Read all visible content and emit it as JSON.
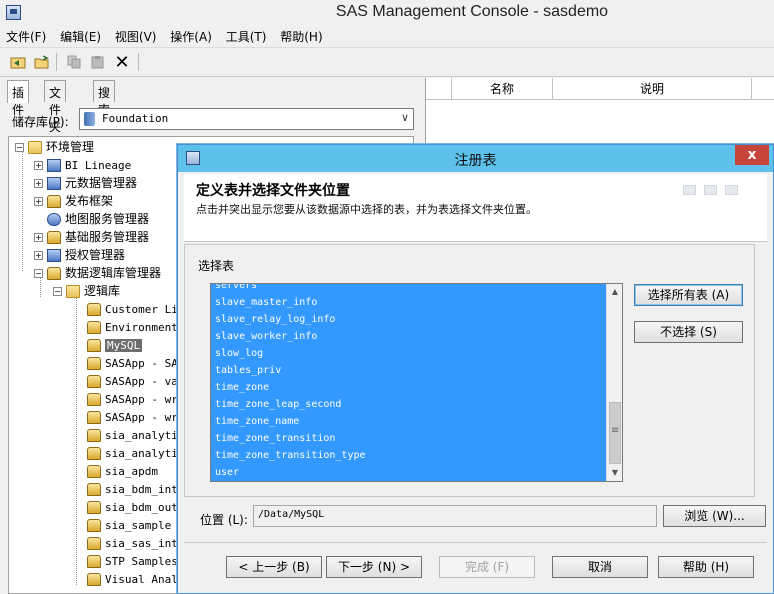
{
  "window": {
    "title": "SAS Management Console - sasdemo"
  },
  "menu": [
    "文件(F)",
    "编辑(E)",
    "视图(V)",
    "操作(A)",
    "工具(T)",
    "帮助(H)"
  ],
  "left_panel": {
    "tabs": [
      "插件",
      "文件夹",
      "搜索"
    ],
    "repository_label": "储存库(P):",
    "repository_value": "Foundation",
    "tree": [
      {
        "label": "环境管理",
        "mono": false
      },
      {
        "label": "BI Lineage",
        "mono": true
      },
      {
        "label": "元数据管理器",
        "mono": false
      },
      {
        "label": "发布框架",
        "mono": false
      },
      {
        "label": "地图服务管理器",
        "mono": false
      },
      {
        "label": "基础服务管理器",
        "mono": false
      },
      {
        "label": "授权管理器",
        "mono": false
      },
      {
        "label": "数据逻辑库管理器",
        "mono": false
      },
      {
        "label": "逻辑库",
        "mono": false
      },
      {
        "label": "Customer Lir",
        "mono": true
      },
      {
        "label": "Environment",
        "mono": true
      },
      {
        "label": "MySQL",
        "mono": true
      },
      {
        "label": "SASApp - SAS",
        "mono": true
      },
      {
        "label": "SASApp - val",
        "mono": true
      },
      {
        "label": "SASApp - wr",
        "mono": true
      },
      {
        "label": "SASApp - wr",
        "mono": true
      },
      {
        "label": "sia_analytic",
        "mono": true
      },
      {
        "label": "sia_analytic",
        "mono": true
      },
      {
        "label": "sia_apdm",
        "mono": true
      },
      {
        "label": "sia_bdm_intr",
        "mono": true
      },
      {
        "label": "sia_bdm_outp",
        "mono": true
      },
      {
        "label": "sia_sample",
        "mono": true
      },
      {
        "label": "sia_sas_intr",
        "mono": true
      },
      {
        "label": "STP Samples",
        "mono": true
      },
      {
        "label": "Visual Analy",
        "mono": true
      }
    ]
  },
  "right_panel": {
    "columns": [
      "名称",
      "说明"
    ]
  },
  "dialog": {
    "title": "注册表",
    "close": "x",
    "heading": "定义表并选择文件夹位置",
    "subheading": "点击并突出显示您要从该数据源中选择的表，并为表选择文件夹位置。",
    "select_label": "选择表",
    "tables": [
      "servers",
      "slave_master_info",
      "slave_relay_log_info",
      "slave_worker_info",
      "slow_log",
      "tables_priv",
      "time_zone",
      "time_zone_leap_second",
      "time_zone_name",
      "time_zone_transition",
      "time_zone_transition_type",
      "user"
    ],
    "select_all": "选择所有表 (A)",
    "deselect": "不选择 (S)",
    "location_label": "位置 (L):",
    "location_value": "/Data/MySQL",
    "browse": "浏览 (W)...",
    "back": "< 上一步 (B)",
    "next": "下一步 (N) >",
    "finish": "完成 (F)",
    "cancel": "取消",
    "help": "帮助 (H)"
  },
  "colors": {
    "accent": "#5ec1ec",
    "selection": "#3399ff",
    "close": "#c7443a"
  }
}
